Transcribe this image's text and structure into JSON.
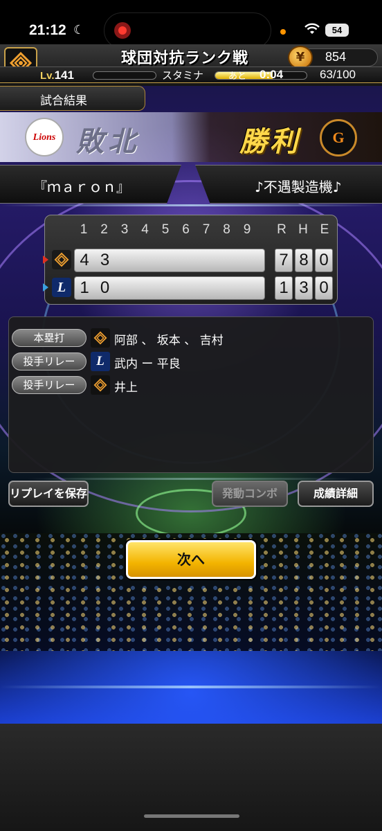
{
  "status_bar": {
    "time": "21:12",
    "moon_icon": "☾",
    "battery": "54"
  },
  "header": {
    "mode_title": "球団対抗ランク戦",
    "coins": "854",
    "level_prefix": "Lv.",
    "level": "141",
    "stamina_label": "スタミナ",
    "recovery_prefix": "あと",
    "recovery_timer": "0:04",
    "stamina_value": "63/100",
    "stamina_fraction": 0.63
  },
  "result": {
    "tab_label": "試合結果",
    "left_team_logo": "Lions",
    "left_result": "敗北",
    "right_result": "勝利",
    "right_team_logo": "G"
  },
  "players": {
    "left": "『ｍａｒｏｎ』",
    "right": "♪不遇製造機♪"
  },
  "scoreboard": {
    "innings": [
      "1",
      "2",
      "3",
      "4",
      "5",
      "6",
      "7",
      "8",
      "9"
    ],
    "rhe_headers": [
      "R",
      "H",
      "E"
    ],
    "rows": [
      {
        "team": "giants",
        "innings": [
          "4",
          "3",
          "",
          "",
          "",
          "",
          "",
          "",
          ""
        ],
        "rhe": [
          "7",
          "8",
          "0"
        ]
      },
      {
        "team": "lions",
        "innings": [
          "1",
          "0",
          "",
          "",
          "",
          "",
          "",
          "",
          ""
        ],
        "rhe": [
          "1",
          "3",
          "0"
        ]
      }
    ]
  },
  "log": [
    {
      "label": "本塁打",
      "team": "giants",
      "text": "阿部 、 坂本 、 吉村"
    },
    {
      "label": "投手リレー",
      "team": "lions",
      "text": "武内 ー 平良"
    },
    {
      "label": "投手リレー",
      "team": "giants",
      "text": "井上"
    }
  ],
  "buttons": {
    "save_replay": "リプレイを保存",
    "combo": "発動コンボ",
    "stats": "成績詳細",
    "next": "次へ"
  },
  "colors": {
    "gold": "#f3b400",
    "giants_orange": "#f08a1c",
    "lions_blue": "#1a3a8a"
  }
}
